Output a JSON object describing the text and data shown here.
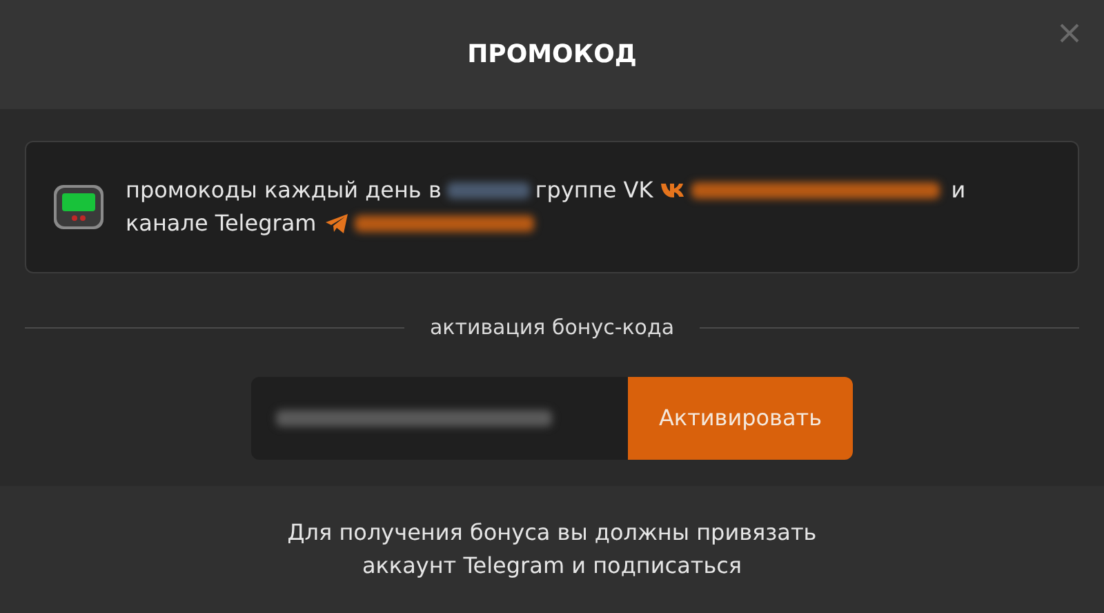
{
  "dialog": {
    "title": "ПРОМОКОД"
  },
  "notice": {
    "parts": [
      "промокоды каждый день в",
      "группе VK",
      "и",
      "канале Telegram"
    ]
  },
  "section": {
    "label": "активация бонус-кода"
  },
  "promo_form": {
    "button": "Активировать"
  },
  "footer": {
    "lines": [
      "Для получения бонуса вы должны привязать",
      "аккаунт Telegram и подписаться"
    ]
  }
}
